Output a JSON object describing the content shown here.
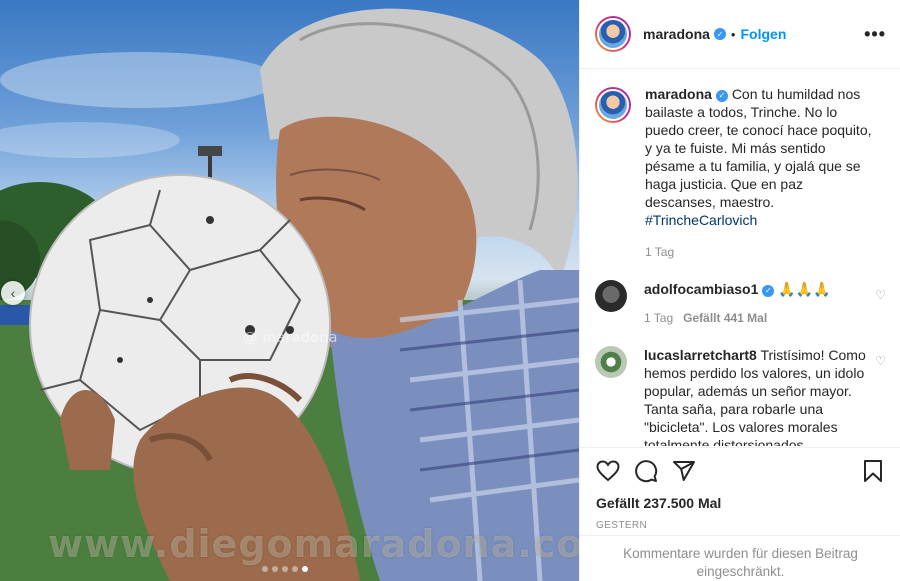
{
  "post": {
    "username": "maradona",
    "follow_label": "Folgen",
    "separator": "•",
    "more_icon": "more-options-icon",
    "image_watermark": "@ maradona",
    "footer_watermark": "www.diegomaradona.com",
    "carousel_count": 5,
    "carousel_active": 4
  },
  "caption": {
    "username": "maradona",
    "text": "Con tu humildad nos bailaste a todos, Trinche. No lo puedo creer, te conocí hace poquito, y ya te fuiste. Mi más sentido pésame a tu familia, y ojalá que se haga justicia. Que en paz descanses, maestro.",
    "hashtag": "#TrincheCarlovich",
    "time": "1 Tag"
  },
  "comments": [
    {
      "username": "adolfocambiaso1",
      "text": "🙏🙏🙏",
      "time": "1 Tag",
      "likes": "Gefällt 441 Mal"
    },
    {
      "username": "lucaslarretchart8",
      "text": "Tristísimo! Como hemos perdido los valores, un idolo popular, además un señor mayor. Tanta saña, para robarle una \"bicicleta\". Los valores morales totalmente distorsionados"
    }
  ],
  "actions": {
    "likes_total": "Gefällt 237.500 Mal",
    "date": "GESTERN",
    "restricted_notice": "Kommentare wurden für diesen Beitrag eingeschränkt."
  },
  "colors": {
    "accent": "#0095f6",
    "verified": "#3897f0",
    "muted": "#8e8e8e",
    "text": "#262626"
  }
}
